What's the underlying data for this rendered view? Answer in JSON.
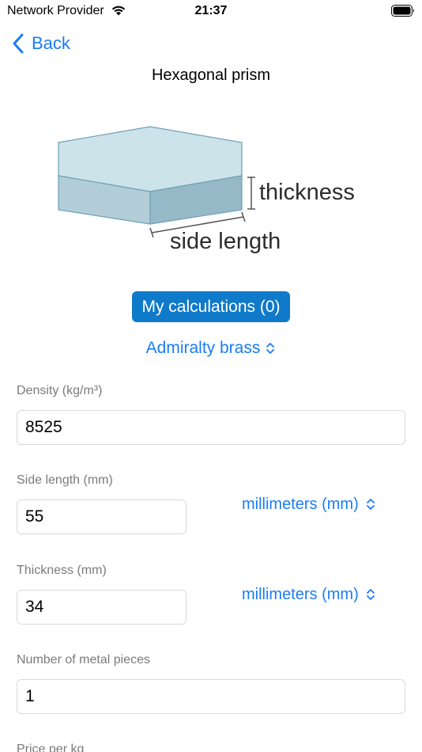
{
  "status_bar": {
    "carrier": "Network Provider",
    "time": "21:37"
  },
  "nav": {
    "back_label": "Back"
  },
  "page": {
    "title": "Hexagonal prism"
  },
  "diagram": {
    "thickness_label": "thickness",
    "side_length_label": "side length"
  },
  "calculations_button": "My calculations (0)",
  "material": {
    "selected": "Admiralty brass"
  },
  "fields": {
    "density": {
      "label": "Density (kg/m³)",
      "value": "8525"
    },
    "side_length": {
      "label": "Side length (mm)",
      "value": "55",
      "unit": "millimeters (mm)"
    },
    "thickness": {
      "label": "Thickness (mm)",
      "value": "34",
      "unit": "millimeters (mm)"
    },
    "pieces": {
      "label": "Number of metal pieces",
      "value": "1"
    },
    "price": {
      "label": "Price per kg"
    }
  },
  "icons": {
    "back": "chevron-left-icon",
    "selector": "chevron-up-down-icon",
    "wifi": "wifi-icon",
    "battery": "battery-icon"
  },
  "colors": {
    "accent": "#1a7cf5",
    "button_bg": "#0f7ac9",
    "prism_top": "#cde3ea",
    "prism_side": "#b2cdd8",
    "prism_side_dark": "#96b9c8"
  }
}
